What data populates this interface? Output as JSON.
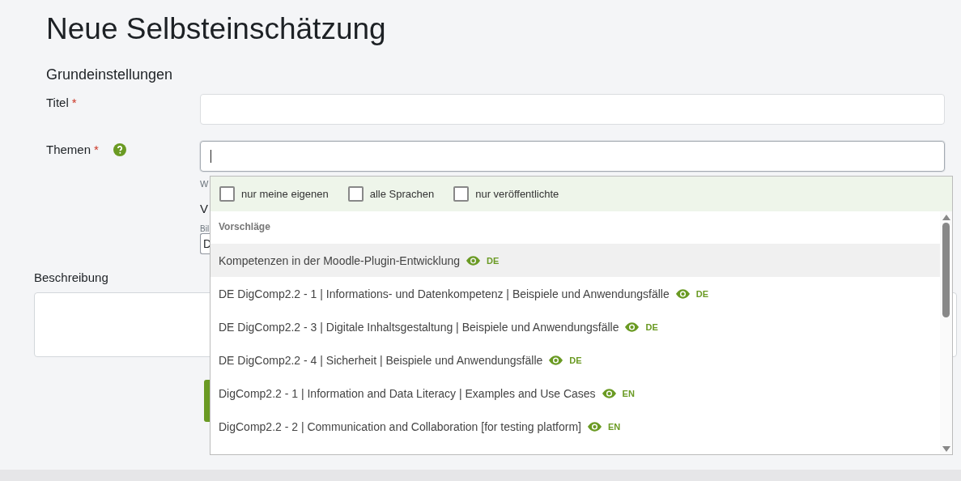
{
  "page_title": "Neue Selbsteinschätzung",
  "section_title": "Grundeinstellungen",
  "fields": [
    {
      "label": "Titel",
      "required_mark": "*",
      "help": false,
      "focused": false
    },
    {
      "label": "Themen",
      "required_mark": "*",
      "help": true,
      "focused": true
    }
  ],
  "hidden_below": {
    "hint": "W",
    "heading": "V",
    "sublabel": "Bil",
    "select_value": "D"
  },
  "description": {
    "label": "Beschreibung"
  },
  "dropdown": {
    "filters": [
      {
        "label": "nur meine eigenen",
        "checked": false
      },
      {
        "label": "alle Sprachen",
        "checked": false
      },
      {
        "label": "nur veröffentlichte",
        "checked": false
      }
    ],
    "header": "Vorschläge",
    "items": [
      {
        "text": "Kompetenzen in der Moodle-Plugin-Entwicklung",
        "lang": "DE",
        "selected": true
      },
      {
        "text": "DE DigComp2.2 - 1 | Informations- und Datenkompetenz | Beispiele und Anwendungsfälle",
        "lang": "DE",
        "selected": false
      },
      {
        "text": "DE DigComp2.2 - 3 | Digitale Inhaltsgestaltung | Beispiele und Anwendungsfälle",
        "lang": "DE",
        "selected": false
      },
      {
        "text": "DE DigComp2.2 - 4 | Sicherheit | Beispiele und Anwendungsfälle",
        "lang": "DE",
        "selected": false
      },
      {
        "text": "DigComp2.2 - 1 | Information and Data Literacy | Examples and Use Cases",
        "lang": "EN",
        "selected": false
      },
      {
        "text": "DigComp2.2 - 2 | Communication and Collaboration [for testing platform]",
        "lang": "EN",
        "selected": false
      }
    ]
  }
}
